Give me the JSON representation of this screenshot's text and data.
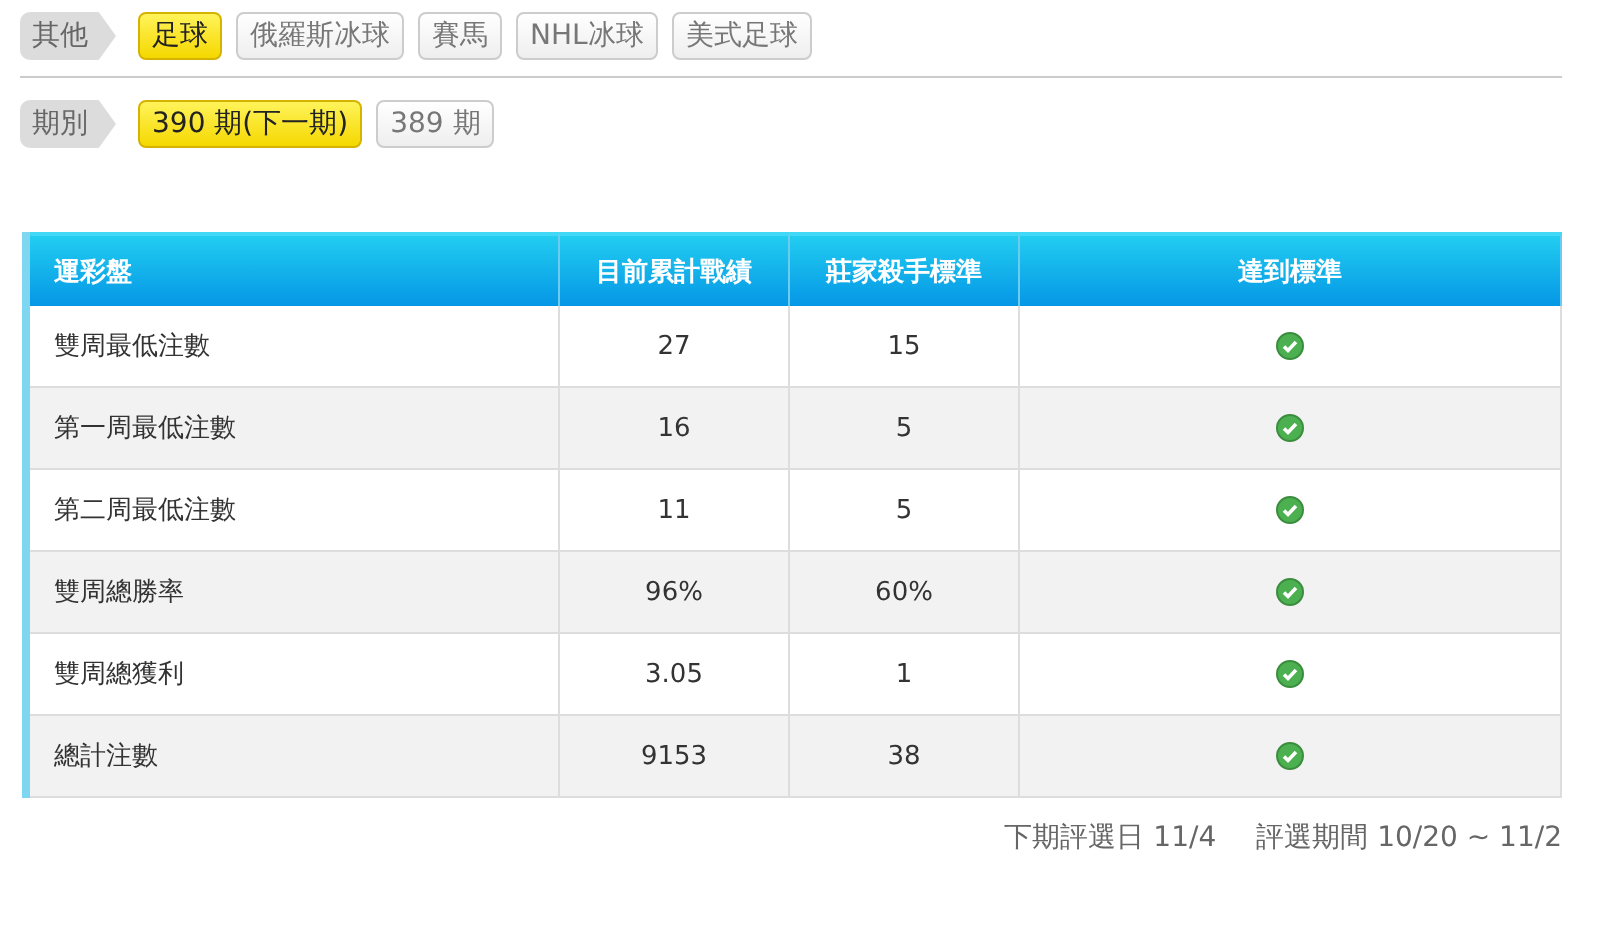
{
  "filters": [
    {
      "label": "其他",
      "options": [
        {
          "label": "足球",
          "selected": true
        },
        {
          "label": "俄羅斯冰球",
          "selected": false
        },
        {
          "label": "賽馬",
          "selected": false
        },
        {
          "label": "NHL冰球",
          "selected": false
        },
        {
          "label": "美式足球",
          "selected": false
        }
      ]
    },
    {
      "label": "期別",
      "options": [
        {
          "label": "390 期(下一期)",
          "selected": true
        },
        {
          "label": "389 期",
          "selected": false
        }
      ]
    }
  ],
  "table": {
    "columns": [
      "運彩盤",
      "目前累計戰績",
      "莊家殺手標準",
      "達到標準"
    ],
    "rows": [
      {
        "name": "雙周最低注數",
        "current": "27",
        "standard": "15",
        "met": true
      },
      {
        "name": "第一周最低注數",
        "current": "16",
        "standard": "5",
        "met": true
      },
      {
        "name": "第二周最低注數",
        "current": "11",
        "standard": "5",
        "met": true
      },
      {
        "name": "雙周總勝率",
        "current": "96%",
        "standard": "60%",
        "met": true
      },
      {
        "name": "雙周總獲利",
        "current": "3.05",
        "standard": "1",
        "met": true
      },
      {
        "name": "總計注數",
        "current": "9153",
        "standard": "38",
        "met": true
      }
    ]
  },
  "footer": {
    "next_date": "下期評選日 11/4",
    "period": "評選期間 10/20 ~ 11/2"
  }
}
